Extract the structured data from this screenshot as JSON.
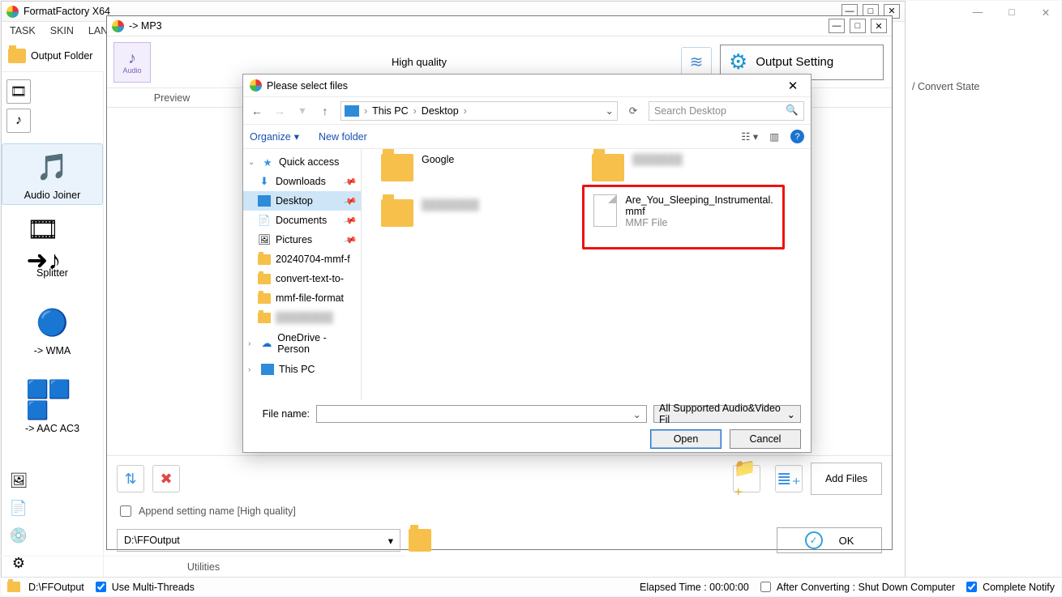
{
  "outer_window": {
    "min": "—",
    "max": "□",
    "close": "✕"
  },
  "main": {
    "title": "FormatFactory X64",
    "win_btns": {
      "min": "—",
      "max": "□",
      "close": "✕"
    },
    "menu": [
      "TASK",
      "SKIN",
      "LANG"
    ],
    "sidebar_top": "Output Folder",
    "sidebar": {
      "items": [
        {
          "label": "Audio Joiner"
        },
        {
          "label": "Splitter"
        },
        {
          "label": "-> WMA"
        },
        {
          "label": "-> AAC AC3"
        }
      ]
    },
    "right_col_header": "/ Convert State"
  },
  "mp3dlg": {
    "title": "-> MP3",
    "win_btns": {
      "min": "—",
      "max": "□",
      "close": "✕"
    },
    "audio_label": "Audio",
    "high_quality": "High quality",
    "output_setting": "Output Setting",
    "col_preview": "Preview",
    "add_files": "Add Files",
    "append": "Append setting name [High quality]",
    "output_path": "D:\\FFOutput",
    "ok": "OK"
  },
  "filedlg": {
    "title": "Please select files",
    "breadcrumb": {
      "pc": "This PC",
      "loc": "Desktop"
    },
    "search_placeholder": "Search Desktop",
    "organize": "Organize",
    "new_folder": "New folder",
    "tree": {
      "quick": "Quick access",
      "downloads": "Downloads",
      "desktop": "Desktop",
      "documents": "Documents",
      "pictures": "Pictures",
      "r1": "20240704-mmf-f",
      "r2": "convert-text-to-",
      "r3": "mmf-file-format",
      "onedrive": "OneDrive - Person",
      "thispc": "This PC"
    },
    "files": {
      "google": "Google",
      "target_name": "Are_You_Sleeping_Instrumental.mmf",
      "target_type": "MMF File"
    },
    "fn_label": "File name:",
    "filter": "All Supported Audio&Video Fil",
    "open": "Open",
    "cancel": "Cancel"
  },
  "utilities_label": "Utilities",
  "status": {
    "path": "D:\\FFOutput",
    "multi": "Use Multi-Threads",
    "elapsed": "Elapsed Time : 00:00:00",
    "after": "After Converting : Shut Down Computer",
    "notify": "Complete Notify"
  }
}
